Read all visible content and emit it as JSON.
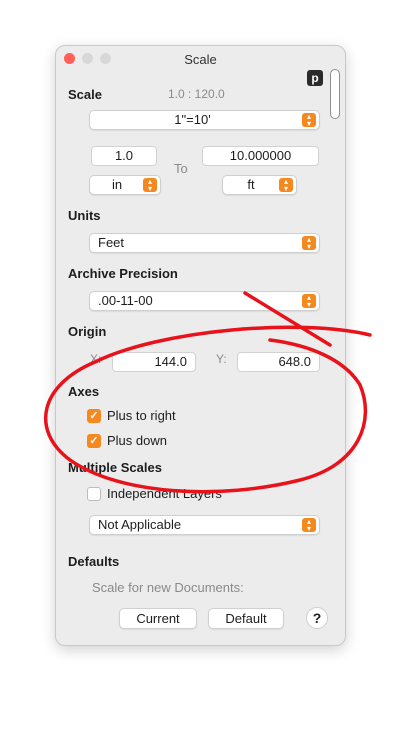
{
  "window": {
    "title": "Scale"
  },
  "badge": {
    "letter": "p"
  },
  "scale": {
    "label": "Scale",
    "ratio": "1.0 : 120.0",
    "preset": "1\"=10'",
    "from_value": "1.0",
    "to_label": "To",
    "to_value": "10.000000",
    "from_unit": "in",
    "to_unit": "ft"
  },
  "units": {
    "label": "Units",
    "value": "Feet"
  },
  "archive": {
    "label": "Archive Precision",
    "value": ".00-11-00"
  },
  "origin": {
    "label": "Origin",
    "x_label": "X:",
    "x_value": "144.0",
    "y_label": "Y:",
    "y_value": "648.0"
  },
  "axes": {
    "label": "Axes",
    "plus_right": {
      "label": "Plus to right",
      "checked": true
    },
    "plus_down": {
      "label": "Plus down",
      "checked": true
    }
  },
  "multiple_scales": {
    "label": "Multiple Scales",
    "independent_layers": {
      "label": "Independent Layers",
      "checked": false
    },
    "value": "Not Applicable"
  },
  "defaults": {
    "label": "Defaults",
    "subtitle": "Scale for new Documents:",
    "current_label": "Current",
    "default_label": "Default",
    "help": "?"
  },
  "colors": {
    "accent": "#f5891f",
    "annotation": "#e8121b"
  }
}
